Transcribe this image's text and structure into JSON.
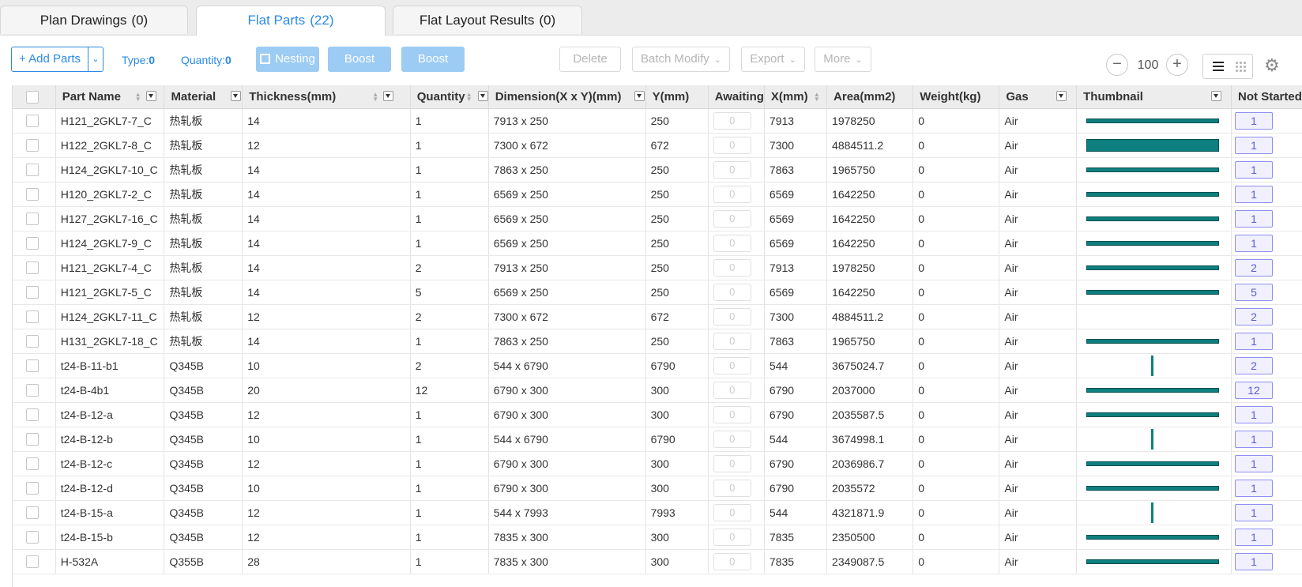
{
  "tabs": [
    {
      "label": "Plan Drawings",
      "count": "(0)"
    },
    {
      "label": "Flat Parts",
      "count": "(22)"
    },
    {
      "label": "Flat Layout Results",
      "count": "(0)"
    }
  ],
  "toolbar": {
    "add_parts": "+ Add Parts",
    "type_label": "Type:",
    "type_value": "0",
    "quantity_label": "Quantity:",
    "quantity_value": "0",
    "nesting": "Nesting",
    "boost1": "Boost",
    "boost2": "Boost",
    "delete": "Delete",
    "batch_modify": "Batch Modify",
    "export": "Export",
    "more": "More",
    "zoom": "100"
  },
  "columns": [
    "",
    "Part Name",
    "Material",
    "Thickness(mm)",
    "Quantity",
    "Dimension(X x Y)(mm)",
    "Y(mm)",
    "Awaiting",
    "X(mm)",
    "Area(mm2)",
    "Weight(kg)",
    "Gas",
    "Thumbnail",
    "Not Started"
  ],
  "rows": [
    {
      "name": "H121_2GKL7-7_C",
      "material": "热轧板",
      "thickness": "14",
      "quantity": "1",
      "dimension": "7913 x 250",
      "y": "250",
      "awaiting": "0",
      "x": "7913",
      "area": "1978250",
      "weight": "0",
      "gas": "Air",
      "thumb": "h",
      "not_started": "1"
    },
    {
      "name": "H122_2GKL7-8_C",
      "material": "热轧板",
      "thickness": "12",
      "quantity": "1",
      "dimension": "7300 x 672",
      "y": "672",
      "awaiting": "0",
      "x": "7300",
      "area": "4884511.2",
      "weight": "0",
      "gas": "Air",
      "thumb": "hw",
      "not_started": "1"
    },
    {
      "name": "H124_2GKL7-10_C",
      "material": "热轧板",
      "thickness": "14",
      "quantity": "1",
      "dimension": "7863 x 250",
      "y": "250",
      "awaiting": "0",
      "x": "7863",
      "area": "1965750",
      "weight": "0",
      "gas": "Air",
      "thumb": "h",
      "not_started": "1"
    },
    {
      "name": "H120_2GKL7-2_C",
      "material": "热轧板",
      "thickness": "14",
      "quantity": "1",
      "dimension": "6569 x 250",
      "y": "250",
      "awaiting": "0",
      "x": "6569",
      "area": "1642250",
      "weight": "0",
      "gas": "Air",
      "thumb": "h",
      "not_started": "1"
    },
    {
      "name": "H127_2GKL7-16_C",
      "material": "热轧板",
      "thickness": "14",
      "quantity": "1",
      "dimension": "6569 x 250",
      "y": "250",
      "awaiting": "0",
      "x": "6569",
      "area": "1642250",
      "weight": "0",
      "gas": "Air",
      "thumb": "h",
      "not_started": "1"
    },
    {
      "name": "H124_2GKL7-9_C",
      "material": "热轧板",
      "thickness": "14",
      "quantity": "1",
      "dimension": "6569 x 250",
      "y": "250",
      "awaiting": "0",
      "x": "6569",
      "area": "1642250",
      "weight": "0",
      "gas": "Air",
      "thumb": "h",
      "not_started": "1"
    },
    {
      "name": "H121_2GKL7-4_C",
      "material": "热轧板",
      "thickness": "14",
      "quantity": "2",
      "dimension": "7913 x 250",
      "y": "250",
      "awaiting": "0",
      "x": "7913",
      "area": "1978250",
      "weight": "0",
      "gas": "Air",
      "thumb": "h",
      "not_started": "2"
    },
    {
      "name": "H121_2GKL7-5_C",
      "material": "热轧板",
      "thickness": "14",
      "quantity": "5",
      "dimension": "6569 x 250",
      "y": "250",
      "awaiting": "0",
      "x": "6569",
      "area": "1642250",
      "weight": "0",
      "gas": "Air",
      "thumb": "h",
      "not_started": "5"
    },
    {
      "name": "H124_2GKL7-11_C",
      "material": "热轧板",
      "thickness": "12",
      "quantity": "2",
      "dimension": "7300 x 672",
      "y": "672",
      "awaiting": "0",
      "x": "7300",
      "area": "4884511.2",
      "weight": "0",
      "gas": "Air",
      "thumb": "none",
      "not_started": "2"
    },
    {
      "name": "H131_2GKL7-18_C",
      "material": "热轧板",
      "thickness": "14",
      "quantity": "1",
      "dimension": "7863 x 250",
      "y": "250",
      "awaiting": "0",
      "x": "7863",
      "area": "1965750",
      "weight": "0",
      "gas": "Air",
      "thumb": "h",
      "not_started": "1"
    },
    {
      "name": "t24-B-11-b1",
      "material": "Q345B",
      "thickness": "10",
      "quantity": "2",
      "dimension": "544 x 6790",
      "y": "6790",
      "awaiting": "0",
      "x": "544",
      "area": "3675024.7",
      "weight": "0",
      "gas": "Air",
      "thumb": "v",
      "not_started": "2"
    },
    {
      "name": "t24-B-4b1",
      "material": "Q345B",
      "thickness": "20",
      "quantity": "12",
      "dimension": "6790 x 300",
      "y": "300",
      "awaiting": "0",
      "x": "6790",
      "area": "2037000",
      "weight": "0",
      "gas": "Air",
      "thumb": "h",
      "not_started": "12"
    },
    {
      "name": "t24-B-12-a",
      "material": "Q345B",
      "thickness": "12",
      "quantity": "1",
      "dimension": "6790 x 300",
      "y": "300",
      "awaiting": "0",
      "x": "6790",
      "area": "2035587.5",
      "weight": "0",
      "gas": "Air",
      "thumb": "h",
      "not_started": "1"
    },
    {
      "name": "t24-B-12-b",
      "material": "Q345B",
      "thickness": "10",
      "quantity": "1",
      "dimension": "544 x 6790",
      "y": "6790",
      "awaiting": "0",
      "x": "544",
      "area": "3674998.1",
      "weight": "0",
      "gas": "Air",
      "thumb": "v",
      "not_started": "1"
    },
    {
      "name": "t24-B-12-c",
      "material": "Q345B",
      "thickness": "12",
      "quantity": "1",
      "dimension": "6790 x 300",
      "y": "300",
      "awaiting": "0",
      "x": "6790",
      "area": "2036986.7",
      "weight": "0",
      "gas": "Air",
      "thumb": "h",
      "not_started": "1"
    },
    {
      "name": "t24-B-12-d",
      "material": "Q345B",
      "thickness": "10",
      "quantity": "1",
      "dimension": "6790 x 300",
      "y": "300",
      "awaiting": "0",
      "x": "6790",
      "area": "2035572",
      "weight": "0",
      "gas": "Air",
      "thumb": "h",
      "not_started": "1"
    },
    {
      "name": "t24-B-15-a",
      "material": "Q345B",
      "thickness": "12",
      "quantity": "1",
      "dimension": "544 x 7993",
      "y": "7993",
      "awaiting": "0",
      "x": "544",
      "area": "4321871.9",
      "weight": "0",
      "gas": "Air",
      "thumb": "v",
      "not_started": "1"
    },
    {
      "name": "t24-B-15-b",
      "material": "Q345B",
      "thickness": "12",
      "quantity": "1",
      "dimension": "7835 x 300",
      "y": "300",
      "awaiting": "0",
      "x": "7835",
      "area": "2350500",
      "weight": "0",
      "gas": "Air",
      "thumb": "h",
      "not_started": "1"
    },
    {
      "name": "H-532A",
      "material": "Q355B",
      "thickness": "28",
      "quantity": "1",
      "dimension": "7835 x 300",
      "y": "300",
      "awaiting": "0",
      "x": "7835",
      "area": "2349087.5",
      "weight": "0",
      "gas": "Air",
      "thumb": "h",
      "not_started": "1"
    }
  ],
  "colors": {
    "accent": "#2b8ae6",
    "part_fill": "#0e7f7f",
    "badge": "#5c5cd6"
  }
}
